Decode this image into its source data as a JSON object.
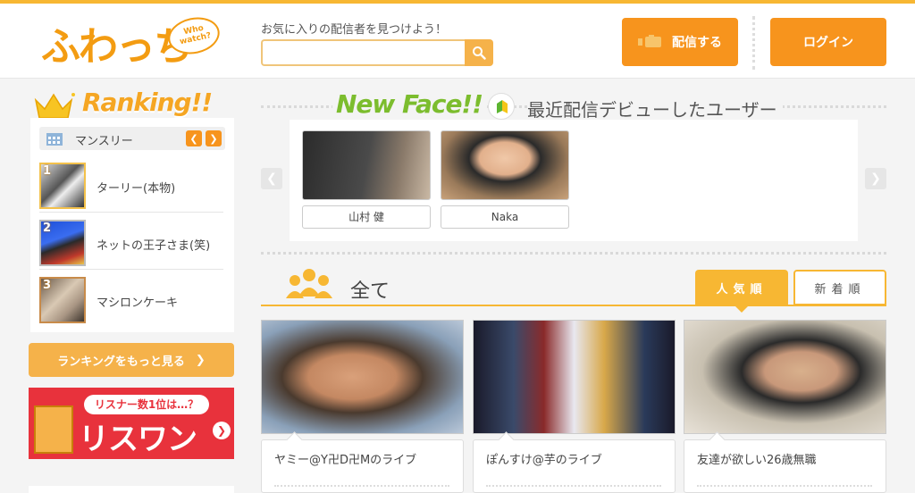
{
  "header": {
    "logo_text": "ふわっち",
    "logo_bubble": "Who watch?",
    "search_label": "お気に入りの配信者を見つけよう！",
    "search_placeholder": "",
    "broadcast_label": "配信する",
    "login_label": "ログイン"
  },
  "ranking": {
    "title": "Ranking!!",
    "period": "マンスリー",
    "items": [
      {
        "rank": "1",
        "name": "ターリー(本物)"
      },
      {
        "rank": "2",
        "name": "ネットの王子さま(笑)"
      },
      {
        "rank": "3",
        "name": "マシロンケーキ"
      }
    ],
    "more_label": "ランキングをもっと見る"
  },
  "banner": {
    "bubble": "リスナー数1位は…？",
    "big": "リスワン"
  },
  "new_face": {
    "title": "New Face!!",
    "subtitle": "最近配信デビューしたユーザー",
    "users": [
      {
        "name": "山村 健"
      },
      {
        "name": "Naka"
      }
    ]
  },
  "all": {
    "title": "全て",
    "sort_popular": "人気順",
    "sort_new": "新着順",
    "lives": [
      {
        "title": "ヤミー@Y卍D卍Mのライブ"
      },
      {
        "title": "ぽんすけ@芋のライブ"
      },
      {
        "title": "友達が欲しい26歳無職"
      }
    ]
  },
  "colors": {
    "accent": "#f7941d",
    "accent_light": "#f7b733",
    "newface_green": "#7cbd2e",
    "banner_red": "#e8323c"
  }
}
